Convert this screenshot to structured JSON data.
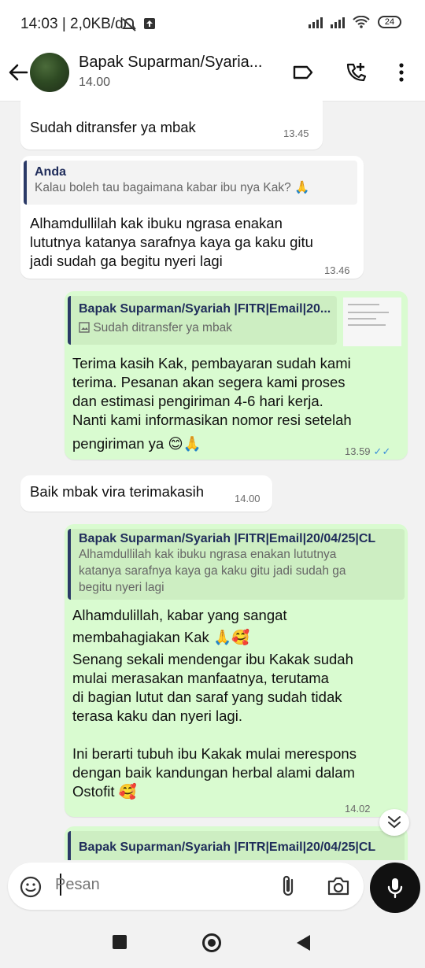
{
  "status_bar": {
    "time": "14:03 | 2,0KB/d",
    "battery": "24"
  },
  "header": {
    "contact_name": "Bapak Suparman/Syaria...",
    "subtitle": "14.00"
  },
  "messages": [
    {
      "text": "Sudah ditransfer ya mbak",
      "time": "13.45"
    },
    {
      "quote_author": "Anda",
      "quote_text": "Kalau boleh tau bagaimana kabar ibu nya Kak? 🙏",
      "lines": [
        "Alhamdullilah kak ibuku ngrasa enakan",
        "lututnya katanya sarafnya kaya ga kaku gitu",
        "jadi sudah ga begitu nyeri lagi"
      ],
      "time": "13.46"
    },
    {
      "quote_author": "Bapak Suparman/Syariah |FITR|Email|20...",
      "quote_text": "Sudah ditransfer ya mbak",
      "lines": [
        "Terima kasih Kak, pembayaran sudah kami",
        "terima. Pesanan akan segera kami proses",
        "dan estimasi pengiriman 4-6 hari kerja.",
        "Nanti kami informasikan nomor resi setelah",
        "pengiriman ya 😊🙏"
      ],
      "time": "13.59",
      "ticks": "✓✓"
    },
    {
      "text": "Baik mbak vira terimakasih",
      "time": "14.00"
    },
    {
      "quote_author": "Bapak Suparman/Syariah |FITR|Email|20/04/25|CL",
      "quote_lines": [
        "Alhamdullilah kak ibuku ngrasa enakan lututnya",
        "katanya sarafnya kaya ga kaku gitu jadi sudah ga",
        "begitu nyeri lagi"
      ],
      "lines": [
        "Alhamdulillah, kabar yang sangat",
        "membahagiakan Kak 🙏🥰",
        "Senang sekali mendengar ibu Kakak sudah",
        "mulai merasakan manfaatnya, terutama",
        "di bagian lutut dan saraf yang sudah tidak",
        "terasa kaku dan nyeri lagi.",
        "",
        "Ini berarti tubuh ibu Kakak mulai merespons",
        "dengan baik kandungan herbal alami dalam",
        "Ostofit 🥰"
      ],
      "time": "14.02"
    },
    {
      "quote_author": "Bapak Suparman/Syariah |FITR|Email|20/04/25|CL"
    }
  ],
  "composer": {
    "placeholder": "Pesan"
  },
  "icons": [
    "back-arrow-icon",
    "label-icon",
    "add-call-icon",
    "more-icon",
    "emoji-icon",
    "attach-icon",
    "camera-icon",
    "mic-icon",
    "chevrons-down-icon",
    "nav-recent-icon",
    "nav-home-icon",
    "nav-back-icon"
  ]
}
